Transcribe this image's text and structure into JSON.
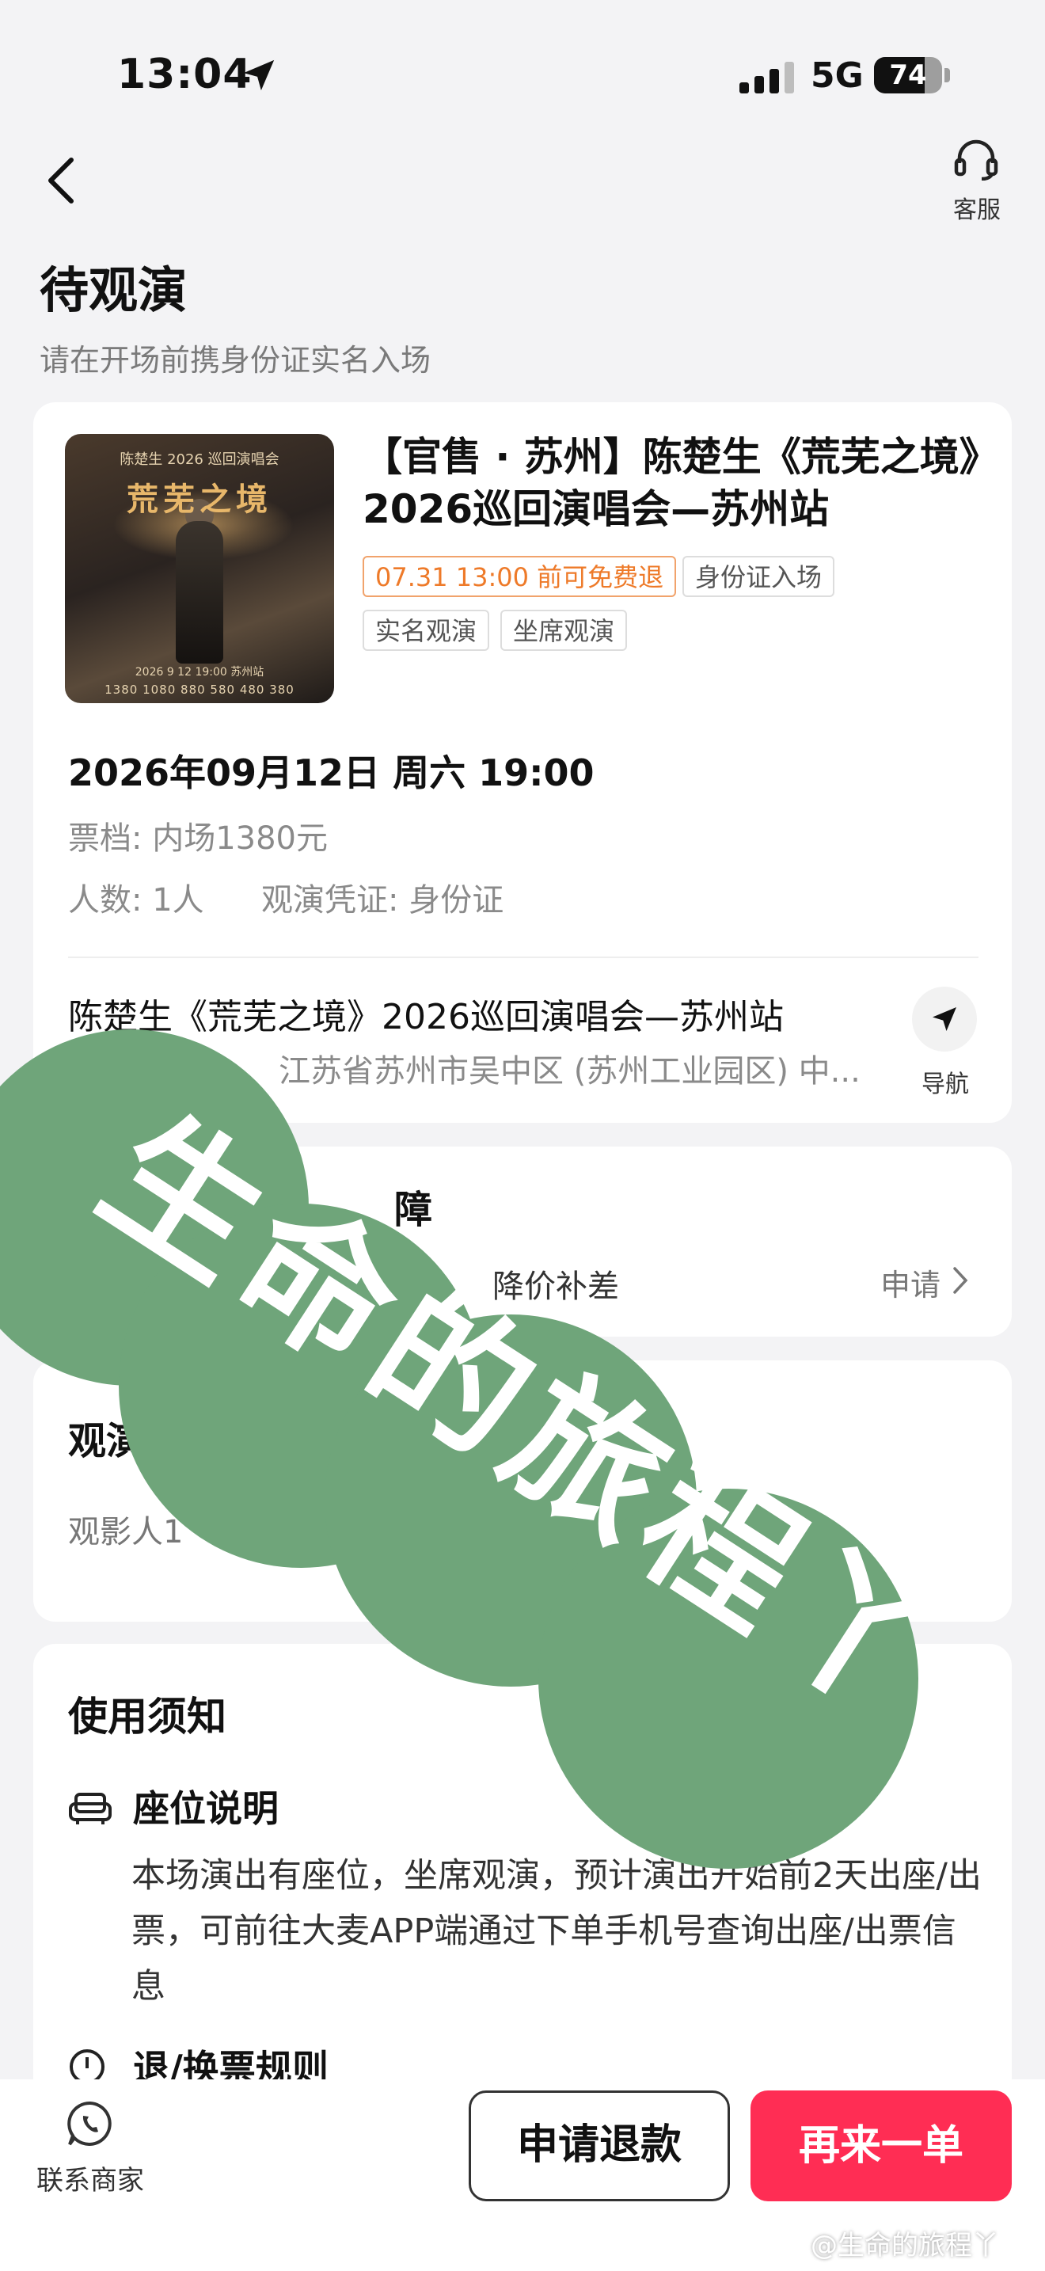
{
  "status_bar": {
    "time": "13:04",
    "network": "5G",
    "battery": "74"
  },
  "header": {
    "service_label": "客服",
    "title": "待观演",
    "subtitle": "请在开场前携身份证实名入场"
  },
  "order": {
    "poster": {
      "top_text": "陈楚生 2026 巡回演唱会",
      "title_text": "荒芜之境",
      "date_text": "2026 9 12 19:00 苏州站",
      "prices_text": "1380 1080 880 580 480 380"
    },
    "event_title": "【官售 · 苏州】陈楚生《荒芜之境》2026巡回演唱会—苏州站",
    "tags": {
      "refund": "07.31 13:00 前可免费退",
      "id_entry": "身份证入场",
      "real_name": "实名观演",
      "seated": "坐席观演"
    },
    "datetime": "2026年09月12日 周六 19:00",
    "ticket_tier": "票档: 内场1380元",
    "people": "人数: 1人",
    "credential": "观演凭证: 身份证",
    "venue_name": "陈楚生《荒芜之境》2026巡回演唱会—苏州站",
    "venue_address": "江苏省苏州市吴中区 (苏州工业园区) 中...",
    "nav_label": "导航"
  },
  "guarantee": {
    "title_fragment": "障",
    "desc_fragment": "降价补差",
    "apply_label": "申请"
  },
  "viewer": {
    "title_fragment": "观演",
    "item": "观影人1"
  },
  "notice": {
    "title": "使用须知",
    "seat_title": "座位说明",
    "seat_text": "本场演出有座位，坐席观演，预计演出开始前2天出座/出票，可前往大麦APP端通过下单手机号查询出座/出票信息",
    "refund_title": "退/换票规则"
  },
  "bottom": {
    "contact_label": "联系商家",
    "refund_button": "申请退款",
    "reorder_button": "再来一单",
    "credit": "@生命的旅程丫"
  },
  "watermark": {
    "text": "生命的旅程丫"
  },
  "colors": {
    "accent": "#ff2d54",
    "tag_orange": "#ee7a29",
    "watermark_green": "#6fa57a"
  }
}
